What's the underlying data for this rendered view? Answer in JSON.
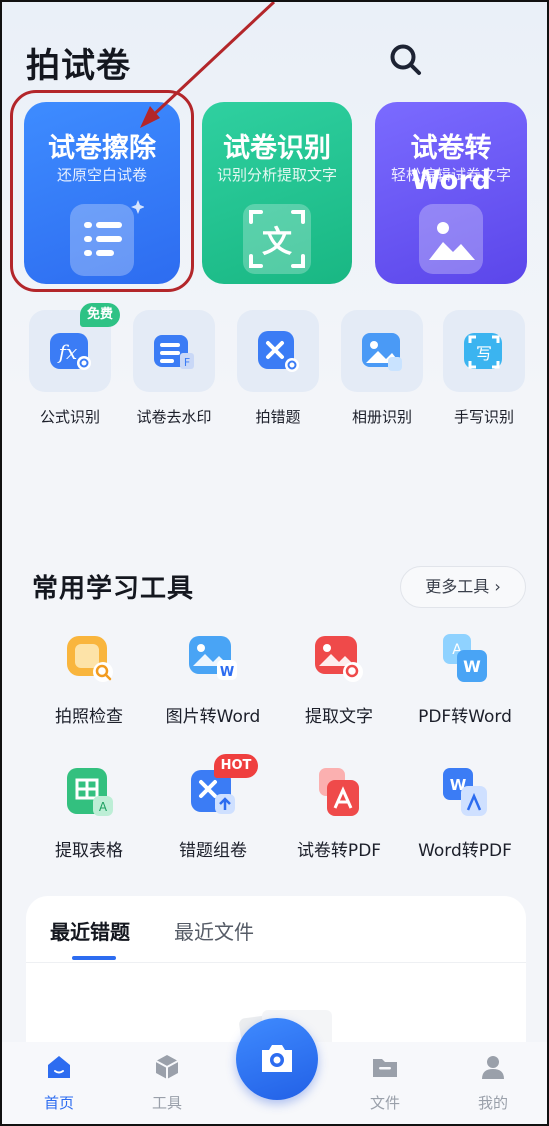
{
  "header": {
    "title": "拍试卷"
  },
  "feature_cards": [
    {
      "title": "试卷擦除",
      "subtitle": "还原空白试卷"
    },
    {
      "title": "试卷识别",
      "subtitle": "识别分析提取文字",
      "icon_text": "文"
    },
    {
      "title": "试卷转Word",
      "subtitle": "轻松编辑试卷文字"
    }
  ],
  "quick_tools": [
    {
      "label": "公式识别",
      "badge": "免费"
    },
    {
      "label": "试卷去水印"
    },
    {
      "label": "拍错题"
    },
    {
      "label": "相册识别"
    },
    {
      "label": "手写识别",
      "icon_text": "写"
    }
  ],
  "common_tools": {
    "title": "常用学习工具",
    "more_label": "更多工具 ›",
    "items": [
      {
        "label": "拍照检查"
      },
      {
        "label": "图片转Word"
      },
      {
        "label": "提取文字"
      },
      {
        "label": "PDF转Word"
      },
      {
        "label": "提取表格"
      },
      {
        "label": "错题组卷",
        "badge": "HOT"
      },
      {
        "label": "试卷转PDF"
      },
      {
        "label": "Word转PDF"
      }
    ]
  },
  "recent": {
    "tabs": [
      {
        "label": "最近错题"
      },
      {
        "label": "最近文件"
      }
    ],
    "active_tab": "最近错题"
  },
  "bottom_nav": [
    {
      "label": "首页",
      "icon": "home-icon"
    },
    {
      "label": "工具",
      "icon": "cube-icon"
    },
    {
      "label": "文件",
      "icon": "folder-icon"
    },
    {
      "label": "我的",
      "icon": "user-icon"
    }
  ],
  "colors": {
    "primary_blue": "#2d6cf0",
    "green": "#19b783",
    "purple": "#5b46ea",
    "annotation_red": "#b3262a"
  }
}
